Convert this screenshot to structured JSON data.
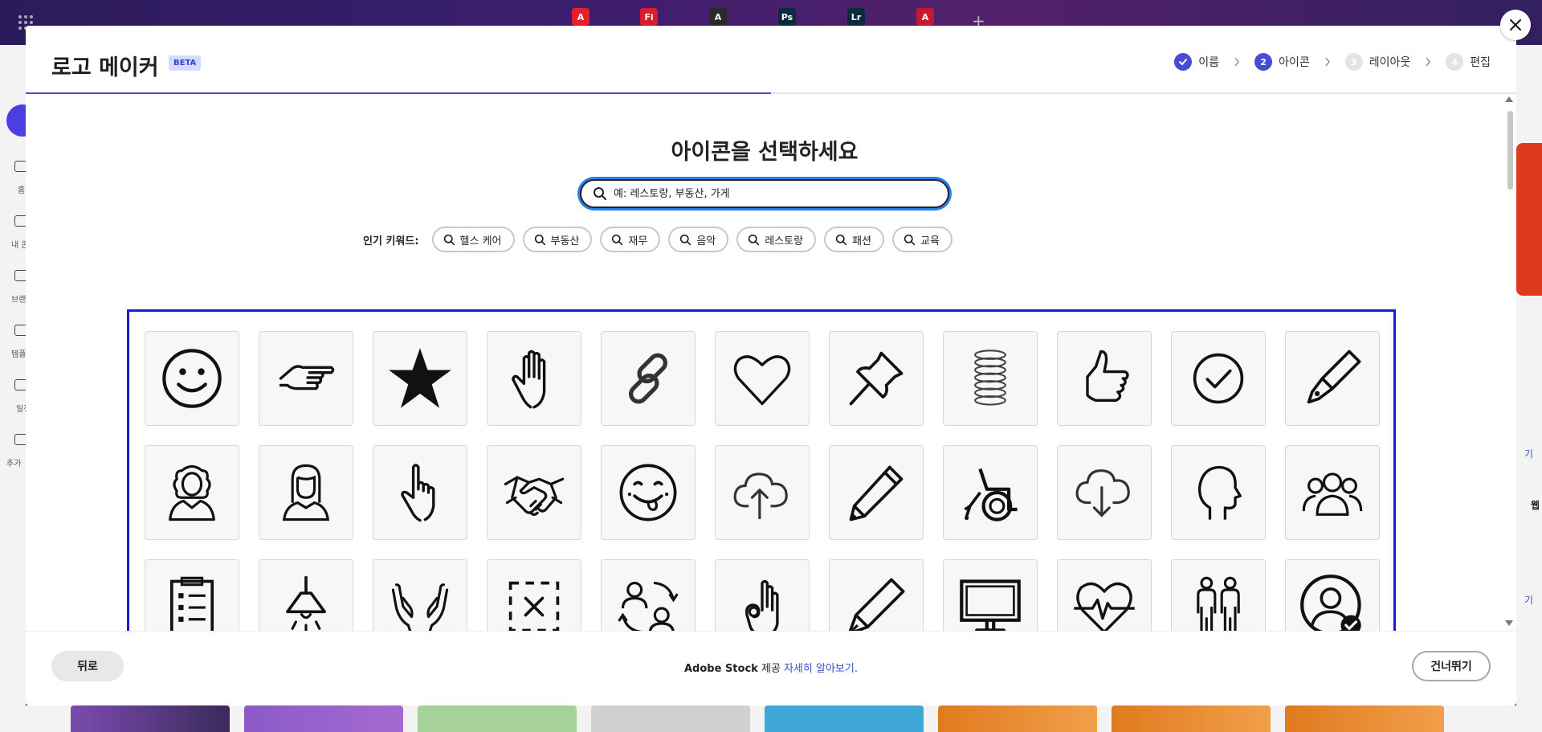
{
  "modal": {
    "title": "로고 메이커",
    "badge": "BETA",
    "steps": [
      {
        "number": "✓",
        "label": "이름",
        "state": "done"
      },
      {
        "number": "2",
        "label": "아이콘",
        "state": "active"
      },
      {
        "number": "3",
        "label": "레이아웃",
        "state": "pending"
      },
      {
        "number": "4",
        "label": "편집",
        "state": "pending"
      }
    ],
    "heading": "아이콘을 선택하세요",
    "search_placeholder": "예: 레스토랑, 부동산, 가게",
    "keywords_label": "인기 키워드:",
    "keywords": [
      "헬스 케어",
      "부동산",
      "재무",
      "음악",
      "레스토랑",
      "패션",
      "교육"
    ],
    "icons": [
      "smiley-face-icon",
      "pointing-hand-icon",
      "star-icon",
      "raised-hand-icon",
      "chain-link-icon",
      "heart-icon",
      "push-pin-icon",
      "coil-spring-icon",
      "thumbs-up-icon",
      "check-circle-icon",
      "fountain-pen-icon",
      "woman-curly-hair-icon",
      "woman-long-hair-icon",
      "hand-pointing-up-icon",
      "handshake-icon",
      "tongue-smiley-icon",
      "cloud-upload-icon",
      "pencil-icon",
      "wheelchair-icon",
      "cloud-download-icon",
      "head-profile-icon",
      "user-group-icon",
      "checklist-clipboard-icon",
      "ceiling-lamp-icon",
      "open-hands-icon",
      "dashed-box-x-icon",
      "people-cycle-icon",
      "ok-hand-icon",
      "pen-icon",
      "monitor-icon",
      "heart-pulse-icon",
      "couple-people-icon",
      "user-check-icon"
    ],
    "footer": {
      "back_label": "뒤로",
      "skip_label": "건너뛰기",
      "attribution_brand": "Adobe Stock",
      "attribution_text": " 제공 ",
      "learn_more": "자세히 알아보기."
    }
  },
  "background": {
    "app_tabs": [
      {
        "label": "A",
        "color": "#e4202c"
      },
      {
        "label": "Fi",
        "color": "#d91c2b"
      },
      {
        "label": "A",
        "color": "#2a2a2a"
      },
      {
        "label": "Ps",
        "color": "#0b2a3f"
      },
      {
        "label": "Lr",
        "color": "#0d2a3b"
      },
      {
        "label": "A",
        "color": "#c8182a"
      }
    ],
    "sidebar_labels": [
      "홈",
      "내 콘",
      "브랜",
      "템플",
      "일정",
      "추가"
    ],
    "right_labels": [
      "기",
      "웹",
      "기"
    ]
  },
  "colors": {
    "accent": "#4a4ad6",
    "selection_frame": "#1b1bd0",
    "focus_ring": "#2680eb"
  }
}
